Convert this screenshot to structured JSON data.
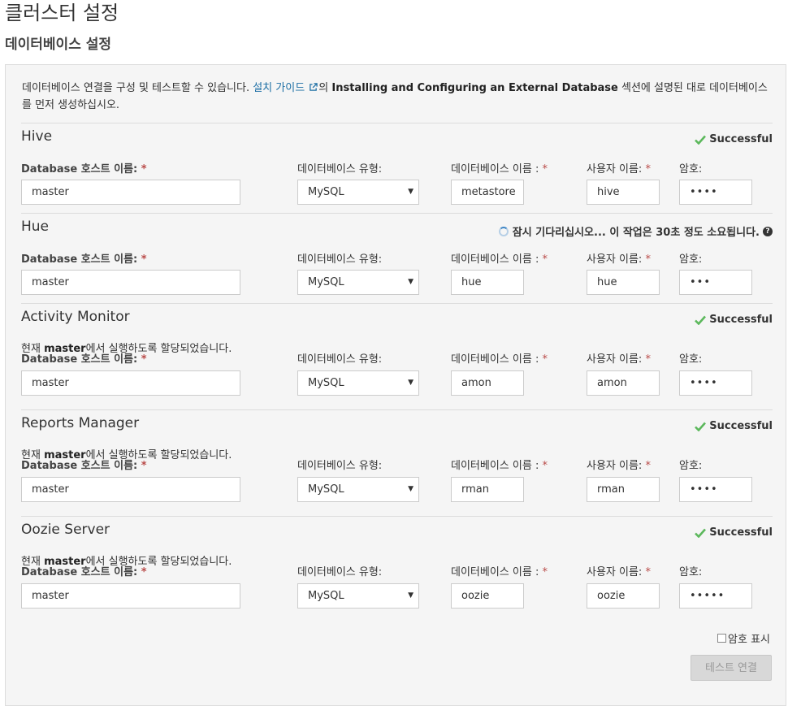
{
  "page": {
    "title": "클러스터 설정",
    "subtitle": "데이터베이스 설정"
  },
  "intro": {
    "text_before": "데이터베이스 연결을 구성 및 테스트할 수 있습니다. ",
    "link_label": "설치 가이드",
    "text_mid": "의 ",
    "bold_text": "Installing and Configuring an External Database",
    "text_after": " 섹션에 설명된 대로 데이터베이스를 먼저 생성하십시오."
  },
  "labels": {
    "host": "Database 호스트 이름:",
    "type": "데이터베이스 유형:",
    "dbname": "데이터베이스 이름 :",
    "user": "사용자 이름:",
    "password": "암호:",
    "required_mark": "*"
  },
  "sections": [
    {
      "title": "Hive",
      "status_text": "Successful",
      "status_kind": "success",
      "assigned_prefix": "",
      "assigned_host": "",
      "assigned_suffix": "",
      "host": "master",
      "type": "MySQL",
      "dbname": "metastore",
      "user": "hive",
      "password": "••••"
    },
    {
      "title": "Hue",
      "status_text": "잠시 기다리십시오... 이 작업은 30초 정도 소요됩니다.",
      "status_kind": "pending",
      "assigned_prefix": "",
      "assigned_host": "",
      "assigned_suffix": "",
      "host": "master",
      "type": "MySQL",
      "dbname": "hue",
      "user": "hue",
      "password": "•••"
    },
    {
      "title": "Activity Monitor",
      "status_text": "Successful",
      "status_kind": "success",
      "assigned_prefix": "현재 ",
      "assigned_host": "master",
      "assigned_suffix": "에서 실행하도록 할당되었습니다.",
      "host": "master",
      "type": "MySQL",
      "dbname": "amon",
      "user": "amon",
      "password": "••••"
    },
    {
      "title": "Reports Manager",
      "status_text": "Successful",
      "status_kind": "success",
      "assigned_prefix": "현재 ",
      "assigned_host": "master",
      "assigned_suffix": "에서 실행하도록 할당되었습니다.",
      "host": "master",
      "type": "MySQL",
      "dbname": "rman",
      "user": "rman",
      "password": "••••"
    },
    {
      "title": "Oozie Server",
      "status_text": "Successful",
      "status_kind": "success",
      "assigned_prefix": "현재 ",
      "assigned_host": "master",
      "assigned_suffix": "에서 실행하도록 할당되었습니다.",
      "host": "master",
      "type": "MySQL",
      "dbname": "oozie",
      "user": "oozie",
      "password": "•••••"
    }
  ],
  "show_password_label": "암호 표시",
  "test_button_label": "테스트 연결",
  "colors": {
    "success_check": "#5cb85c",
    "link": "#1c6ea4",
    "required": "#b94a48"
  }
}
